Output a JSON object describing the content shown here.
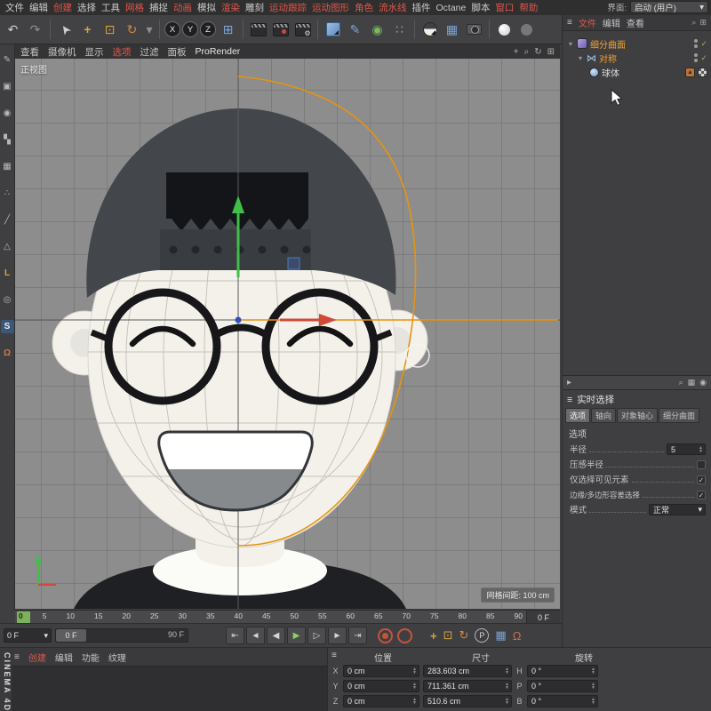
{
  "ui_colors": {
    "accent_red": "#e0564a",
    "selected_orange": "#f0a030",
    "tool_yellow": "#d9a33a",
    "menubar_bg": "#2f2f30",
    "panel_bg": "#3f3f41",
    "viewport_bg": "#8d8d8d"
  },
  "icons": {
    "menu": "≡",
    "undo": "↶",
    "redo": "↷",
    "cursor": "➤",
    "move": "+",
    "scale": "⊡",
    "rotate": "↻",
    "dropdown": "▾",
    "grid": "⊞",
    "gear": "⚙",
    "pen": "✎",
    "sphere": "◉",
    "cluster": "∷",
    "search": "⌕",
    "chev_right": "▸",
    "check": "✓",
    "bowtie": "⋈",
    "magnet": "Ω",
    "pla_grid": "▦",
    "param": "P",
    "pan": "+",
    "zoom": "⌕",
    "rotate_view": "↻",
    "maximize": "⊞"
  },
  "menubar": {
    "items": [
      {
        "label": "文件"
      },
      {
        "label": "编辑"
      },
      {
        "label": "创建"
      },
      {
        "label": "选择"
      },
      {
        "label": "工具"
      },
      {
        "label": "网格"
      },
      {
        "label": "捕捉"
      },
      {
        "label": "动画"
      },
      {
        "label": "模拟"
      },
      {
        "label": "渲染"
      },
      {
        "label": "雕刻"
      },
      {
        "label": "运动跟踪"
      },
      {
        "label": "运动图形"
      },
      {
        "label": "角色"
      },
      {
        "label": "流水线"
      },
      {
        "label": "插件"
      },
      {
        "label": "Octane"
      },
      {
        "label": "脚本"
      },
      {
        "label": "窗口"
      },
      {
        "label": "帮助"
      }
    ]
  },
  "interface": {
    "label": "界面:",
    "value": "启动 (用户)"
  },
  "toolbar": {
    "axis_locks": [
      "X",
      "Y",
      "Z"
    ]
  },
  "left_toolbar": {
    "items": [
      {
        "name": "sculpt-tool",
        "glyph": "✎"
      },
      {
        "name": "make-editable",
        "glyph": "▣"
      },
      {
        "name": "model-mode",
        "glyph": "◉"
      },
      {
        "name": "texture-mode",
        "glyph": "▚"
      },
      {
        "name": "workplane-mode",
        "glyph": "▦"
      },
      {
        "name": "points-mode",
        "glyph": "∴"
      },
      {
        "name": "edges-mode",
        "glyph": "╱"
      },
      {
        "name": "polygons-mode",
        "glyph": "△"
      },
      {
        "name": "enable-axis-mode",
        "glyph": "L"
      },
      {
        "name": "viewport-filter",
        "glyph": "◎"
      },
      {
        "name": "snap-mode",
        "glyph": "S"
      },
      {
        "name": "magnet-mode",
        "glyph": "Ω"
      }
    ]
  },
  "viewport": {
    "menu": [
      {
        "label": "查看"
      },
      {
        "label": "摄像机"
      },
      {
        "label": "显示"
      },
      {
        "label": "选项"
      },
      {
        "label": "过滤"
      },
      {
        "label": "面板"
      },
      {
        "label": "ProRender"
      }
    ],
    "view_label": "正视图",
    "grid_label": "网格间距: 100 cm",
    "spline_color": "#e6940f",
    "axis_x_color": "#cf4a38",
    "axis_y_color": "#3fbf4a",
    "axis_z_color": "#4a78d0"
  },
  "character": {
    "cap": "#43474c",
    "cap_strap": "#393d42",
    "strap_dots": "#24262a",
    "hair": "#141518",
    "skin": "#f4f1ea",
    "skin_shadow": "#e6e4de",
    "glasses": "#17171a",
    "mouth_fill": "#ffffff",
    "mouth_lower": "#868a8d",
    "mouth_outline": "#32363a",
    "shirt": "#1e2023",
    "collar": "#fbfbf8"
  },
  "object_manager": {
    "menu": [
      {
        "label": "文件"
      },
      {
        "label": "编辑"
      },
      {
        "label": "查看"
      }
    ],
    "objects": [
      {
        "name": "细分曲面"
      },
      {
        "name": "对称"
      },
      {
        "name": "球体"
      }
    ]
  },
  "attribute_manager": {
    "title": "实时选择",
    "tabs": [
      {
        "label": "选项"
      },
      {
        "label": "轴向"
      },
      {
        "label": "对象轴心"
      },
      {
        "label": "细分曲面"
      }
    ],
    "section": "选项",
    "props": {
      "radius_label": "半径",
      "radius_value": "5",
      "pressure_label": "压感半径",
      "pressure_checked": false,
      "visible_label": "仅选择可见元素",
      "visible_checked": true,
      "tolerant_label": "边缘/多边形容差选择",
      "tolerant_checked": true,
      "mode_label": "模式",
      "mode_value": "正常"
    }
  },
  "timeline": {
    "ticks": [
      "0",
      "5",
      "10",
      "15",
      "20",
      "25",
      "30",
      "35",
      "40",
      "45",
      "50",
      "55",
      "60",
      "65",
      "70",
      "75",
      "80",
      "85",
      "90"
    ],
    "current_frame_box": "0 F",
    "frame_field": "0 F",
    "slider_start": "0 F",
    "slider_end": "90 F",
    "transport": [
      {
        "name": "goto-start-button",
        "glyph": "⇤"
      },
      {
        "name": "previous-key-button",
        "glyph": "◄"
      },
      {
        "name": "previous-frame-button",
        "glyph": "◀"
      },
      {
        "name": "play-button",
        "glyph": "▶"
      },
      {
        "name": "next-frame-button",
        "glyph": "▷"
      },
      {
        "name": "next-key-button",
        "glyph": "►"
      },
      {
        "name": "goto-end-button",
        "glyph": "⇥"
      }
    ]
  },
  "materials": {
    "tabs": [
      {
        "label": "创建"
      },
      {
        "label": "编辑"
      },
      {
        "label": "功能"
      },
      {
        "label": "纹理"
      }
    ]
  },
  "coordinates": {
    "headers": [
      "位置",
      "尺寸",
      "旋转"
    ],
    "rows": [
      {
        "axis": "X",
        "position": "0 cm",
        "size": "283.603 cm",
        "rot_axis": "H",
        "rotation": "0 °"
      },
      {
        "axis": "Y",
        "position": "0 cm",
        "size": "711.361 cm",
        "rot_axis": "P",
        "rotation": "0 °"
      },
      {
        "axis": "Z",
        "position": "0 cm",
        "size": "510.6 cm",
        "rot_axis": "B",
        "rotation": "0 °"
      }
    ]
  },
  "brand": {
    "logo": "CINEMA 4D"
  }
}
